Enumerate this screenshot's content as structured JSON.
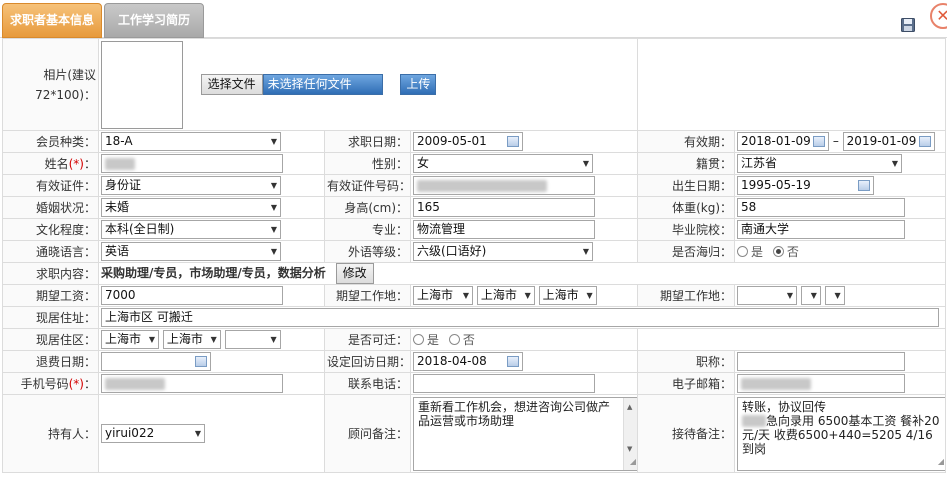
{
  "tabs": [
    {
      "label": "求职者基本信息",
      "active": true
    },
    {
      "label": "工作学习简历",
      "active": false
    }
  ],
  "photo": {
    "label": "相片(建议72*100)：",
    "choose_file": "选择文件",
    "no_file": "未选择任何文件",
    "upload": "上传"
  },
  "row1": {
    "member_label": "会员种类：",
    "member_value": "18-A",
    "apply_date_label": "求职日期：",
    "apply_date_value": "2009-05-01",
    "valid_label": "有效期：",
    "valid_from": "2018-01-09",
    "valid_sep": "–",
    "valid_to": "2019-01-09"
  },
  "row2": {
    "name_label": "姓名",
    "req_mark": "(*)",
    "colon": "：",
    "gender_label": "性别：",
    "gender_value": "女",
    "native_label": "籍贯：",
    "native_value": "江苏省"
  },
  "row3": {
    "id_type_label": "有效证件：",
    "id_type_value": "身份证",
    "id_no_label": "有效证件号码：",
    "birth_label": "出生日期：",
    "birth_value": "1995-05-19"
  },
  "row4": {
    "marital_label": "婚姻状况：",
    "marital_value": "未婚",
    "height_label": "身高(cm)：",
    "height_value": "165",
    "weight_label": "体重(kg)：",
    "weight_value": "58"
  },
  "row5": {
    "edu_label": "文化程度：",
    "edu_value": "本科(全日制)",
    "major_label": "专业：",
    "major_value": "物流管理",
    "school_label": "毕业院校：",
    "school_value": "南通大学"
  },
  "row6": {
    "lang_label": "通晓语言：",
    "lang_value": "英语",
    "lang_level_label": "外语等级：",
    "lang_level_value": "六级(口语好)",
    "overseas_label": "是否海归：",
    "yes": "是",
    "no": "否"
  },
  "row7": {
    "job_label": "求职内容：",
    "job_value": "采购助理/专员，市场助理/专员，数据分析",
    "edit": "修改"
  },
  "row8": {
    "salary_label": "期望工资：",
    "salary_value": "7000",
    "work_place_label": "期望工作地：",
    "wp1": "上海市",
    "wp2": "上海市",
    "wp3": "上海市",
    "work_place2_label": "期望工作地："
  },
  "row9": {
    "addr_label": "现居住址：",
    "addr_value": "上海市区 可搬迁"
  },
  "row10": {
    "area_label": "现居住区：",
    "area1": "上海市",
    "area2": "上海市",
    "relocate_label": "是否可迁：",
    "yes": "是",
    "no": "否"
  },
  "row11": {
    "refund_label": "退费日期：",
    "visit_label": "设定回访日期：",
    "visit_value": "2018-04-08",
    "title_label": "职称："
  },
  "row12": {
    "phone_label": "手机号码",
    "req_mark": "(*)",
    "colon": "：",
    "tel_label": "联系电话：",
    "email_label": "电子邮箱："
  },
  "row13": {
    "holder_label": "持有人：",
    "holder_value": "yirui022",
    "advisor_label": "顾问备注：",
    "advisor_value": "重新看工作机会，想进咨询公司做产品运营或市场助理",
    "recept_label": "接待备注：",
    "recept_line1": "转账，协议回传",
    "recept_line2": "急向录用  6500基本工资  餐补20元/天  收费6500+440=5205  4/16到岗"
  },
  "icons": {
    "save": "floppy-disk-icon",
    "close": "close-icon"
  }
}
